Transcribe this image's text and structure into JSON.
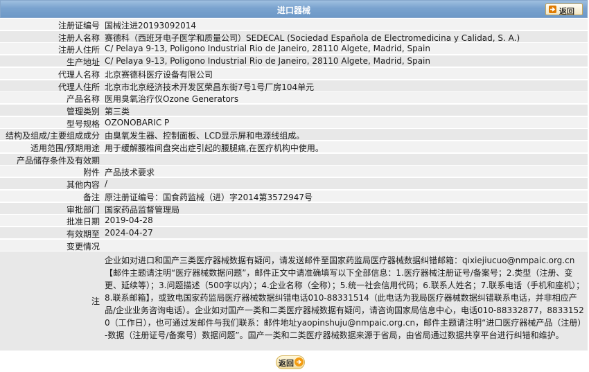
{
  "header": {
    "title": "进口器械",
    "back_label": "返回"
  },
  "fields": [
    {
      "label": "注册证编号",
      "value": "国械注进20193092014"
    },
    {
      "label": "注册人名称",
      "value": "赛德科（西班牙电子医学和质量公司）SEDECAL (Sociedad Española de Electromedicina y Calidad, S. A.)"
    },
    {
      "label": "注册人住所",
      "value": "C/ Pelaya 9-13, Poligono Industrial Rio de Janeiro, 28110 Algete, Madrid, Spain"
    },
    {
      "label": "生产地址",
      "value": "C/ Pelaya 9-13, Poligono Industrial Rio de Janeiro, 28110 Algete, Madrid, Spain"
    },
    {
      "label": "代理人名称",
      "value": "北京赛德科医疗设备有限公司"
    },
    {
      "label": "代理人住所",
      "value": "北京市北京经济技术开发区荣昌东街7号1号厂房104单元"
    },
    {
      "label": "产品名称",
      "value": "医用臭氧治疗仪Ozone Generators"
    },
    {
      "label": "管理类别",
      "value": "第三类"
    },
    {
      "label": "型号规格",
      "value": "OZONOBARIC P"
    },
    {
      "label": "结构及组成/主要组成成分",
      "value": "由臭氧发生器、控制面板、LCD显示屏和电源线组成。"
    },
    {
      "label": "适用范围/预期用途",
      "value": "用于缓解腰椎间盘突出症引起的腰腿痛,在医疗机构中使用。"
    },
    {
      "label": "产品储存条件及有效期",
      "value": ""
    },
    {
      "label": "附件",
      "value": "产品技术要求"
    },
    {
      "label": "其他内容",
      "value": "/"
    },
    {
      "label": "备注",
      "value": "原注册证编号：国食药监械（进）字2014第3572947号"
    },
    {
      "label": "审批部门",
      "value": "国家药品监督管理局"
    },
    {
      "label": "批准日期",
      "value": "2019-04-28"
    },
    {
      "label": "有效期至",
      "value": "2024-04-27"
    },
    {
      "label": "变更情况",
      "value": ""
    }
  ],
  "note": {
    "label": "注",
    "text": "企业如对进口和国产三类医疗器械数据有疑问，请发送邮件至国家药监局医疗器械数据纠错邮箱：qixiejiucuo@nmpaic.org.cn【邮件主题请注明“医疗器械数据问题”，邮件正文中请准确填写以下全部信息：1.医疗器械注册证号/备案号；2.类型（注册、变更、延续等）；3.问题描述（500字以内）；4.企业名称（全称）；5.统一社会信用代码；6.联系人姓名；7.联系电话（手机和座机）；8.联系邮箱】，或致电国家药监局医疗器械数据纠错电话010-88331514（此电话为我局医疗器械数据纠错联系电话，并非相应产品/企业业务咨询电话）。企业如对国产一类和二类医疗器械数据有疑问，请咨询国家局信息中心，电话010-88332877，88331520（工作日），也可通过发邮件与我们联系：邮件地址yaopinshuju@nmpaic.org.cn，邮件主题请注明“进口医疗器械产品（注册）-数据（注册证号/备案号）数据问题”。国产一类和二类医疗器械数据来源于省局，由省局通过数据共享平台进行纠错和维护。"
  },
  "footer": {
    "back_label": "返回"
  },
  "colors": {
    "header_bg": "#7aa3cf",
    "row_odd": "#f2f2f2",
    "row_even": "#e8e8e8",
    "button_icon": "#f39c12"
  }
}
